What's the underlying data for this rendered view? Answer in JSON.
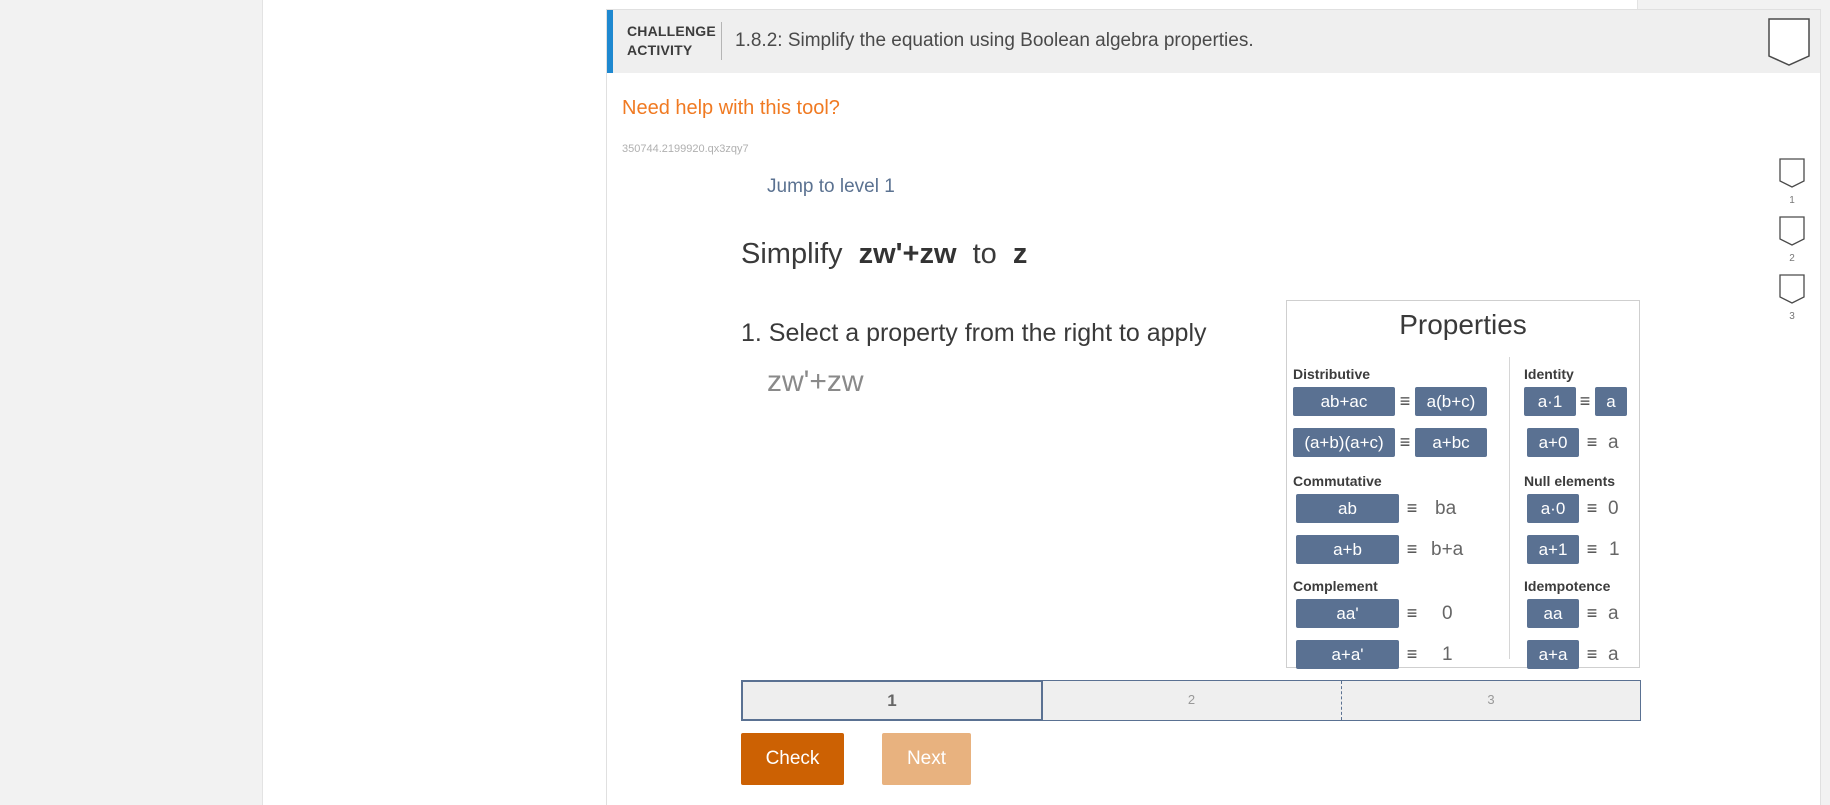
{
  "header": {
    "tag_line1": "CHALLENGE",
    "tag_line2": "ACTIVITY",
    "title": "1.8.2: Simplify the equation using Boolean algebra properties."
  },
  "help_link": "Need help with this tool?",
  "activity_id": "350744.2199920.qx3zqy7",
  "jump_link": "Jump to level 1",
  "prompt": {
    "lead": "Simplify",
    "expr": "zw'+zw",
    "connector": "to",
    "target": "z"
  },
  "step": {
    "instruction": "1. Select a property from the right to apply",
    "current_expression": "zw'+zw"
  },
  "properties": {
    "title": "Properties",
    "equiv": "≡",
    "distributive": {
      "label": "Distributive",
      "r1_left": "ab+ac",
      "r1_right": "a(b+c)",
      "r2_left": "(a+b)(a+c)",
      "r2_right": "a+bc"
    },
    "commutative": {
      "label": "Commutative",
      "r1_left": "ab",
      "r1_right": "ba",
      "r2_left": "a+b",
      "r2_right": "b+a"
    },
    "complement": {
      "label": "Complement",
      "r1_left": "aa'",
      "r1_right": "0",
      "r2_left": "a+a'",
      "r2_right": "1"
    },
    "identity": {
      "label": "Identity",
      "r1_left": "a·1",
      "r1_right": "a",
      "r2_left": "a+0",
      "r2_right": "a"
    },
    "null_elements": {
      "label": "Null elements",
      "r1_left": "a·0",
      "r1_right": "0",
      "r2_left": "a+1",
      "r2_right": "1"
    },
    "idempotence": {
      "label": "Idempotence",
      "r1_left": "aa",
      "r1_right": "a",
      "r2_left": "a+a",
      "r2_right": "a"
    }
  },
  "levels": [
    "1",
    "2",
    "3"
  ],
  "progress": {
    "current_level": "1",
    "steps": [
      "1",
      "2",
      "3"
    ]
  },
  "buttons": {
    "check": "Check",
    "next": "Next"
  },
  "colors": {
    "accent": "#1e88d0",
    "property_button": "#5a7192",
    "check": "#cc6103",
    "next_disabled": "#e8b27f",
    "help_link": "#f07a22"
  }
}
